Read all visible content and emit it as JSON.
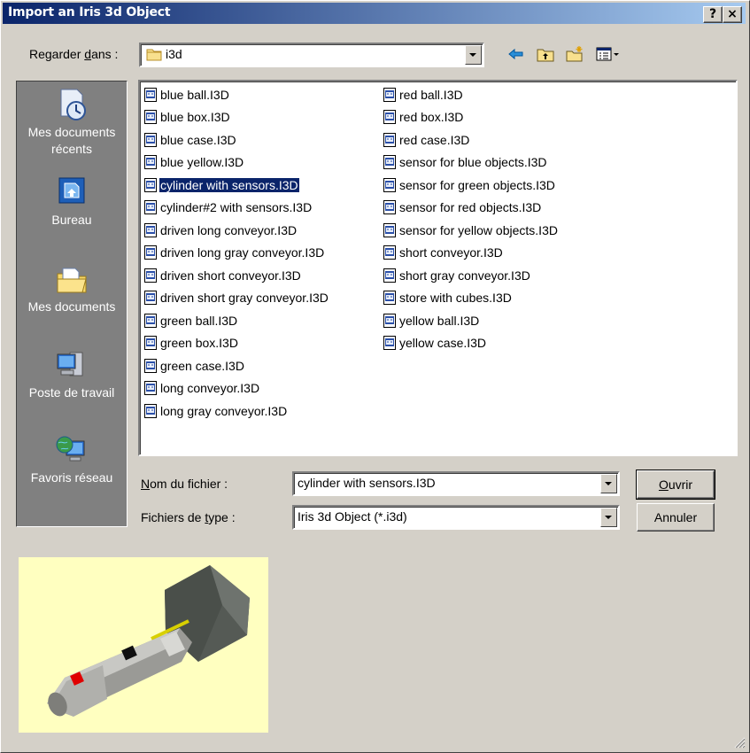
{
  "window": {
    "title": "Import an Iris 3d Object",
    "help_label": "?",
    "close_label": "×"
  },
  "lookin": {
    "label_prefix": "Regarder ",
    "label_underlined": "d",
    "label_suffix": "ans :",
    "value": "i3d"
  },
  "places": [
    {
      "label": "Mes documents récents",
      "icon": "recent-documents-icon"
    },
    {
      "label": "Bureau",
      "icon": "desktop-icon"
    },
    {
      "label": "Mes documents",
      "icon": "my-documents-icon"
    },
    {
      "label": "Poste de travail",
      "icon": "my-computer-icon"
    },
    {
      "label": "Favoris réseau",
      "icon": "network-places-icon"
    }
  ],
  "files_col1": [
    "blue ball.I3D",
    "blue box.I3D",
    "blue case.I3D",
    "blue yellow.I3D",
    "cylinder with sensors.I3D",
    "cylinder#2 with sensors.I3D",
    "driven long conveyor.I3D",
    "driven long gray conveyor.I3D",
    "driven short conveyor.I3D",
    "driven short gray conveyor.I3D",
    "green ball.I3D",
    "green box.I3D",
    "green case.I3D",
    "long conveyor.I3D",
    "long gray conveyor.I3D"
  ],
  "files_col2": [
    "red ball.I3D",
    "red box.I3D",
    "red case.I3D",
    "sensor for blue objects.I3D",
    "sensor for green objects.I3D",
    "sensor for red objects.I3D",
    "sensor for yellow objects.I3D",
    "short conveyor.I3D",
    "short gray conveyor.I3D",
    "store with cubes.I3D",
    "yellow ball.I3D",
    "yellow case.I3D"
  ],
  "selected_file": "cylinder with sensors.I3D",
  "filename": {
    "label_underlined": "N",
    "label_rest": "om du fichier :",
    "value": "cylinder with sensors.I3D"
  },
  "filetype": {
    "label_prefix": "Fichiers de ",
    "label_underlined": "t",
    "label_suffix": "ype :",
    "value": "Iris 3d Object (*.i3d)"
  },
  "buttons": {
    "open_underlined": "O",
    "open_rest": "uvrir",
    "cancel": "Annuler"
  },
  "colors": {
    "titlebar_start": "#0a246a",
    "titlebar_end": "#a6caf0",
    "selection": "#0a246a",
    "preview_bg": "#ffffc0"
  }
}
